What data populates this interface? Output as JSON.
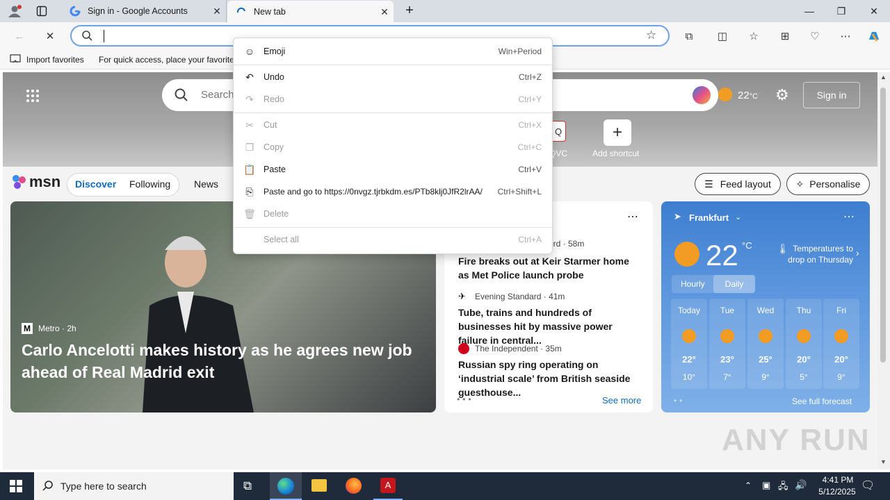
{
  "browser": {
    "tabs": [
      {
        "title": "Sign in - Google Accounts",
        "active": false
      },
      {
        "title": "New tab",
        "active": true
      }
    ],
    "address": {
      "value": "",
      "placeholder": ""
    },
    "favorites_bar": {
      "import_label": "Import favorites",
      "hint": "For quick access, place your favorites"
    }
  },
  "context_menu": {
    "items": [
      {
        "label": "Emoji",
        "shortcut": "Win+Period",
        "icon": "emoji-icon",
        "enabled": true
      },
      {
        "label": "Undo",
        "shortcut": "Ctrl+Z",
        "icon": "undo-icon",
        "enabled": true
      },
      {
        "label": "Redo",
        "shortcut": "Ctrl+Y",
        "icon": "redo-icon",
        "enabled": false
      },
      {
        "label": "Cut",
        "shortcut": "Ctrl+X",
        "icon": "cut-icon",
        "enabled": false
      },
      {
        "label": "Copy",
        "shortcut": "Ctrl+C",
        "icon": "copy-icon",
        "enabled": false
      },
      {
        "label": "Paste",
        "shortcut": "Ctrl+V",
        "icon": "paste-icon",
        "enabled": true
      },
      {
        "label": "Paste and go to https://0nvgz.tjrbkdm.es/PTb8klj0JfR2lrAA/",
        "shortcut": "Ctrl+Shift+L",
        "icon": "paste-go-icon",
        "enabled": true
      },
      {
        "label": "Delete",
        "shortcut": "",
        "icon": "delete-icon",
        "enabled": false
      },
      {
        "label": "Select all",
        "shortcut": "Ctrl+A",
        "icon": "",
        "enabled": false
      }
    ]
  },
  "msn": {
    "search_placeholder": "Search",
    "temperature": "22",
    "temp_unit": "°C",
    "sign_in": "Sign in",
    "shortcuts": [
      {
        "label": "QVC"
      },
      {
        "label": "Add shortcut"
      }
    ],
    "logo": "msn",
    "nav": [
      "Discover",
      "Following",
      "News"
    ],
    "feed_layout": "Feed layout",
    "personalise": "Personalise",
    "hero_story": {
      "source": "Metro",
      "age": "2h",
      "headline": "Carlo Ancelotti makes history as he agrees new job ahead of Real Madrid exit"
    },
    "news_list": [
      {
        "source": "",
        "age": "ord · 58m",
        "headline": "Fire breaks out at Keir Starmer home as Met Police launch probe"
      },
      {
        "source": "Evening Standard",
        "age": "41m",
        "headline": "Tube, trains and hundreds of businesses hit by massive power failure in central..."
      },
      {
        "source": "The Independent",
        "age": "35m",
        "headline": "Russian spy ring operating on ‘industrial scale’ from British seaside guesthouse..."
      }
    ],
    "see_more": "See more",
    "weather": {
      "city": "Frankfurt",
      "temp": "22",
      "unit": "°C",
      "note": "Temperatures to drop on Thursday",
      "tabs": [
        "Hourly",
        "Daily"
      ],
      "days": [
        {
          "day": "Today",
          "hi": "22°",
          "lo": "10°"
        },
        {
          "day": "Tue",
          "hi": "23°",
          "lo": "7°"
        },
        {
          "day": "Wed",
          "hi": "25°",
          "lo": "9°"
        },
        {
          "day": "Thu",
          "hi": "20°",
          "lo": "5°"
        },
        {
          "day": "Fri",
          "hi": "20°",
          "lo": "9°"
        }
      ],
      "full_forecast": "See full forecast"
    }
  },
  "taskbar": {
    "search_placeholder": "Type here to search",
    "time": "4:41 PM",
    "date": "5/12/2025"
  },
  "watermark": "ANY RUN",
  "colors": {
    "accent": "#0f6cbd",
    "address_border": "#6fa3e8",
    "taskbar": "#1f2a3a"
  }
}
